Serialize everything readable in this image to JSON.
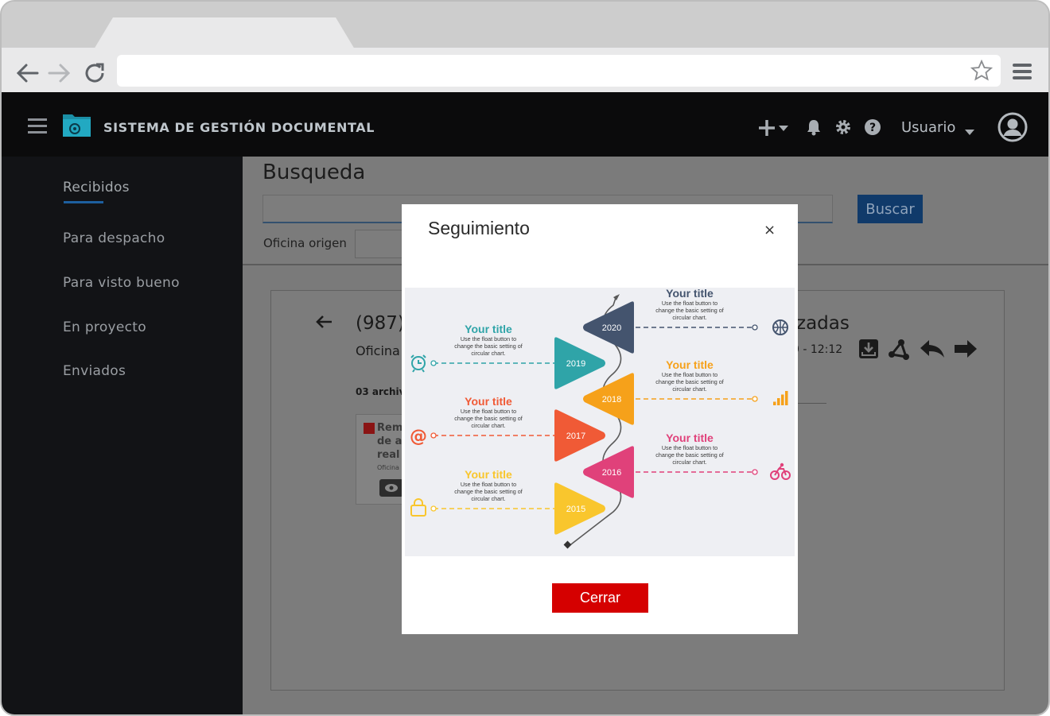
{
  "app": {
    "title": "SISTEMA DE GESTIÓN DOCUMENTAL",
    "user": "Usuario"
  },
  "sidebar": {
    "items": [
      {
        "label": "Recibidos",
        "active": true
      },
      {
        "label": "Para despacho"
      },
      {
        "label": "Para visto bueno"
      },
      {
        "label": "En proyecto"
      },
      {
        "label": "Enviados"
      }
    ]
  },
  "search": {
    "heading": "Busqueda",
    "button": "Buscar",
    "origin_label": "Oficina origen"
  },
  "detail": {
    "title_left": "(987)",
    "title_right": "zadas",
    "subtitle": "Oficina",
    "date_fragment": "0 - 12:12",
    "files_label": "03 archiv",
    "file_name_lines": [
      "Rem",
      "de a",
      "real"
    ],
    "file_office": "Oficina"
  },
  "modal": {
    "title": "Seguimiento",
    "close_symbol": "×",
    "close_button": "Cerrar"
  },
  "timeline": {
    "body_text": [
      "Use the float button to",
      "change the basic setting of",
      "circular chart."
    ],
    "steps": [
      {
        "year": "2020",
        "title": "Your title",
        "color": "#44546e",
        "icon": "basketball-icon"
      },
      {
        "year": "2019",
        "title": "Your title",
        "color": "#2fa4a8",
        "icon": "alarm-clock-icon"
      },
      {
        "year": "2018",
        "title": "Your title",
        "color": "#f6a11a",
        "icon": "signal-bars-icon"
      },
      {
        "year": "2017",
        "title": "Your title",
        "color": "#f05a36",
        "icon": "at-sign-icon"
      },
      {
        "year": "2016",
        "title": "Your title",
        "color": "#e0417a",
        "icon": "bicycle-icon"
      },
      {
        "year": "2015",
        "title": "Your title",
        "color": "#f9c62d",
        "icon": "shopping-bag-icon"
      }
    ]
  },
  "colors": {
    "accent_red": "#d50000",
    "header_bg": "#0b0b0c",
    "sidebar_bg": "#121316"
  }
}
